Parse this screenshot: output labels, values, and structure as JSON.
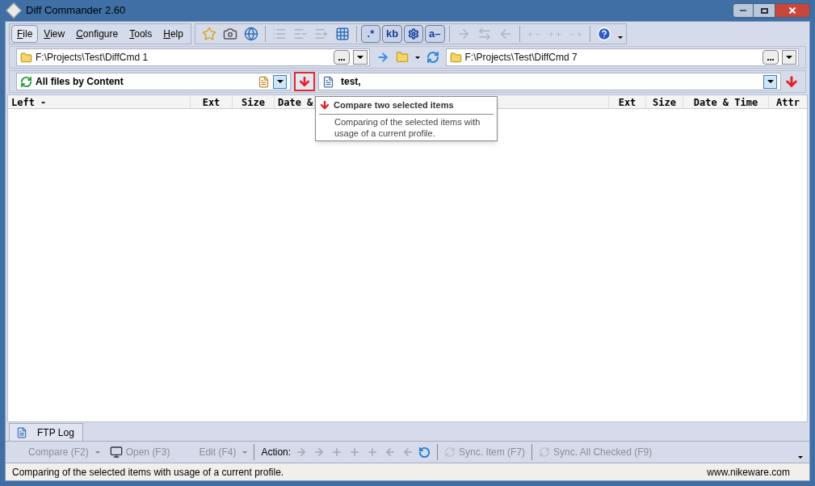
{
  "window": {
    "title": "Diff Commander 2.60"
  },
  "menu": [
    {
      "label": "File",
      "selected": true
    },
    {
      "label": "View",
      "selected": false
    },
    {
      "label": "Configure",
      "selected": false
    },
    {
      "label": "Tools",
      "selected": false
    },
    {
      "label": "Help",
      "selected": false
    }
  ],
  "toolbar": [
    {
      "kind": "icon",
      "disabled": false
    },
    {
      "kind": "icon",
      "disabled": false
    },
    {
      "kind": "icon",
      "disabled": false
    },
    {
      "kind": "sep"
    },
    {
      "kind": "icon",
      "disabled": true
    },
    {
      "kind": "icon",
      "disabled": true
    },
    {
      "kind": "icon",
      "disabled": true
    },
    {
      "kind": "icon",
      "disabled": false
    },
    {
      "kind": "sep"
    },
    {
      "kind": "toggle",
      "label": ".*",
      "pressed": true
    },
    {
      "kind": "toggle",
      "label": "kb",
      "pressed": true
    },
    {
      "kind": "toggle-icon",
      "pressed": true
    },
    {
      "kind": "toggle",
      "label": "a–",
      "pressed": true
    },
    {
      "kind": "sep"
    },
    {
      "kind": "icon",
      "disabled": true
    },
    {
      "kind": "icon",
      "disabled": true
    },
    {
      "kind": "icon",
      "disabled": true
    },
    {
      "kind": "sep"
    },
    {
      "kind": "icon",
      "disabled": true
    },
    {
      "kind": "icon",
      "disabled": true
    },
    {
      "kind": "icon",
      "disabled": true
    },
    {
      "kind": "sep"
    },
    {
      "kind": "icon",
      "disabled": false
    }
  ],
  "left_path": {
    "value": "F:\\Projects\\Test\\DiffCmd 1"
  },
  "right_path": {
    "value": "F:\\Projects\\Test\\DiffCmd 7"
  },
  "filter": {
    "profile": "All files by Content",
    "mask": "test,"
  },
  "compare_button": {
    "highlighted": true
  },
  "left_columns": [
    "Left -",
    "Ext",
    "Size",
    "Date &"
  ],
  "right_columns": [
    "Ext",
    "Size",
    "Date & Time",
    "Attr"
  ],
  "tooltip": {
    "title": "Compare two selected items",
    "text": "Comparing of the selected items with usage of a current profile."
  },
  "bottom_tabs": [
    {
      "label": "FTP Log",
      "selected": true
    }
  ],
  "actions": {
    "compare": "Compare (F2)",
    "open": "Open (F3)",
    "edit": "Edit (F4)",
    "action_label": "Action:",
    "sync_item": "Sync. Item (F7)",
    "sync_all": "Sync. All Checked (F9)"
  },
  "status_bar": {
    "text": "Comparing of the selected items with usage of a current profile.",
    "url": "www.nikeware.com"
  }
}
